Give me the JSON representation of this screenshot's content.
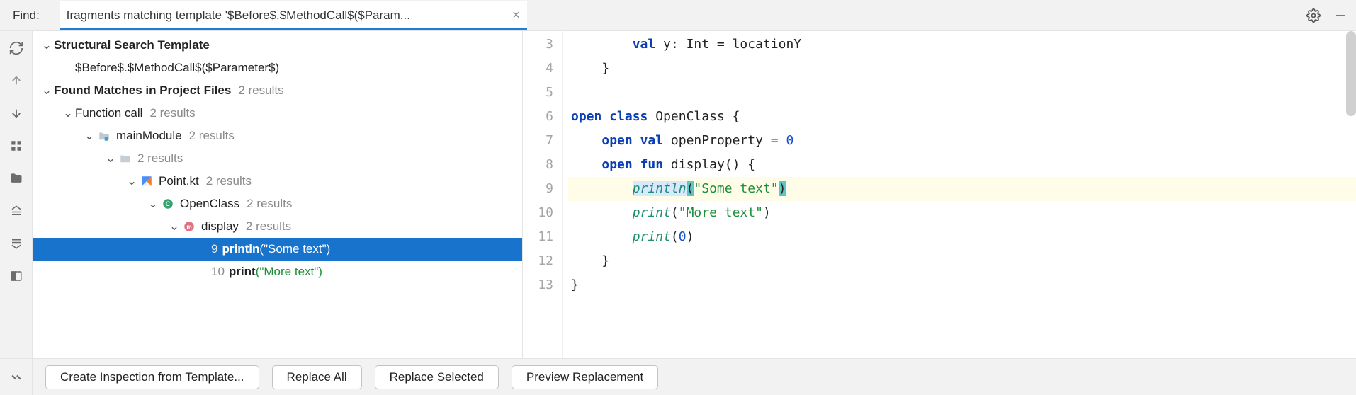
{
  "find": {
    "label": "Find:",
    "query": "fragments matching template '$Before$.$MethodCall$($Param..."
  },
  "tree": {
    "template_header": "Structural Search Template",
    "template_text": "$Before$.$MethodCall$($Parameter$)",
    "found_header": "Found Matches in Project Files",
    "found_count": "2 results",
    "function_call": "Function call",
    "function_call_count": "2 results",
    "module": "mainModule",
    "module_count": "2 results",
    "folder_count": "2 results",
    "file": "Point.kt",
    "file_count": "2 results",
    "klass": "OpenClass",
    "klass_count": "2 results",
    "method": "display",
    "method_count": "2 results",
    "match1_line": "9",
    "match1_call": "println",
    "match1_arg": "(\"Some text\")",
    "match2_line": "10",
    "match2_call": "print",
    "match2_arg": "(\"More text\")"
  },
  "editor": {
    "lines": [
      "3",
      "4",
      "5",
      "6",
      "7",
      "8",
      "9",
      "10",
      "11",
      "12",
      "13"
    ],
    "l3": {
      "pre": "        ",
      "kw1": "val",
      "mid1": " y: Int = locationY"
    },
    "l4": "    }",
    "l5": "",
    "l6": {
      "pre": "",
      "kw1": "open",
      "s1": " ",
      "kw2": "class",
      "s2": " ",
      "name": "OpenClass",
      "tail": " {"
    },
    "l7": {
      "pre": "    ",
      "kw1": "open",
      "s1": " ",
      "kw2": "val",
      "s2": " ",
      "name": "openProperty = ",
      "num": "0"
    },
    "l8": {
      "pre": "    ",
      "kw1": "open",
      "s1": " ",
      "kw2": "fun",
      "s2": " ",
      "name": "display",
      "tail": "() {"
    },
    "l9": {
      "pre": "        ",
      "fn": "println",
      "p1": "(",
      "str": "\"Some text\"",
      "p2": ")"
    },
    "l10": {
      "pre": "        ",
      "fn": "print",
      "p1": "(",
      "str": "\"More text\"",
      "p2": ")"
    },
    "l11": {
      "pre": "        ",
      "fn": "print",
      "p1": "(",
      "num": "0",
      "p2": ")"
    },
    "l12": "    }",
    "l13": "}"
  },
  "buttons": {
    "create": "Create Inspection from Template...",
    "replace_all": "Replace All",
    "replace_selected": "Replace Selected",
    "preview": "Preview Replacement"
  }
}
